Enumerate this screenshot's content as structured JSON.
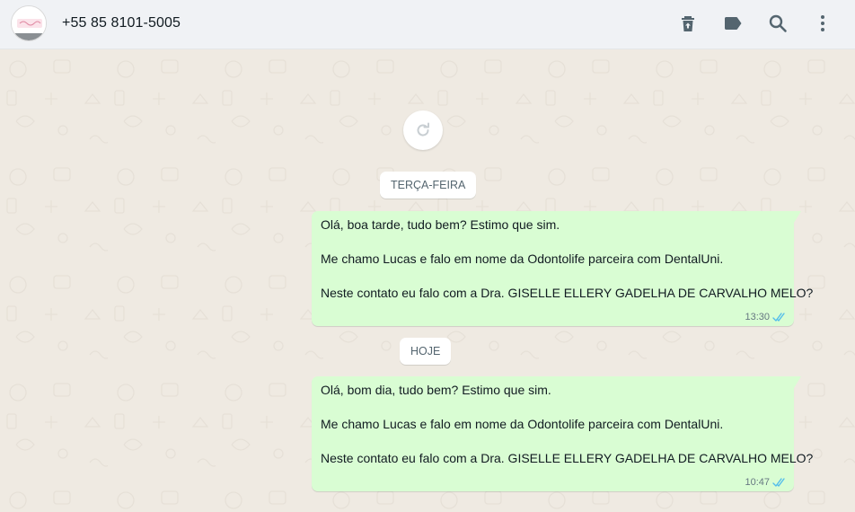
{
  "header": {
    "contact_name": "+55 85 8101-5005",
    "icons": [
      "delete-icon",
      "label-icon",
      "search-icon",
      "menu-icon"
    ]
  },
  "chat": {
    "load_more_icon": "refresh-icon",
    "sections": [
      {
        "date_label": "TERÇA-FEIRA",
        "message": {
          "lines": [
            "Olá, boa tarde, tudo bem? Estimo que sim.",
            "",
            "Me chamo Lucas e falo em nome da Odontolife parceira com DentalUni.",
            "",
            "Neste contato eu falo com a Dra. GISELLE ELLERY GADELHA DE CARVALHO MELO?"
          ],
          "time": "13:30",
          "status_icon": "double-check-icon"
        }
      },
      {
        "date_label": "HOJE",
        "message": {
          "lines": [
            "Olá, bom dia, tudo bem? Estimo que sim.",
            "",
            "Me chamo Lucas e falo em nome da Odontolife parceira com DentalUni.",
            "",
            "Neste contato eu falo com a Dra. GISELLE ELLERY GADELHA DE CARVALHO MELO?"
          ],
          "time": "10:47",
          "status_icon": "double-check-icon"
        }
      }
    ]
  },
  "colors": {
    "outgoing_bubble": "#d9fdd3",
    "chat_background": "#efeae2",
    "header_background": "#f0f2f5",
    "read_check": "#53bdeb",
    "icon_gray": "#54656f"
  }
}
